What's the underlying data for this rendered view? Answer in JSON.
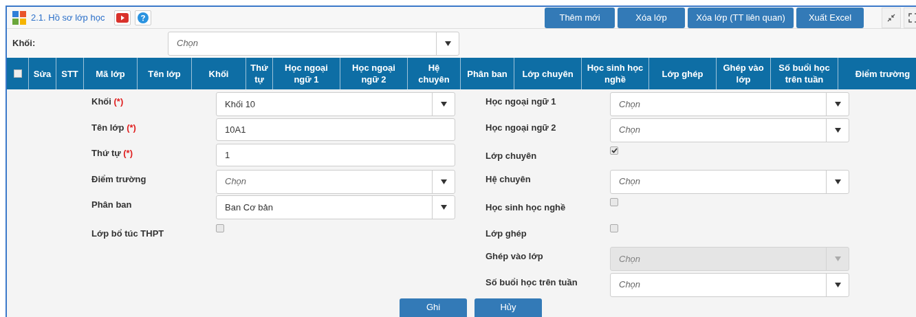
{
  "header": {
    "title": "2.1. Hồ sơ lớp học",
    "actions": [
      "Thêm mới",
      "Xóa lớp",
      "Xóa lớp (TT liên quan)",
      "Xuất Excel"
    ]
  },
  "filter": {
    "label": "Khối:",
    "placeholder": "Chọn"
  },
  "table": {
    "select_all_checked": false,
    "columns": [
      "Sửa",
      "STT",
      "Mã lớp",
      "Tên lớp",
      "Khối",
      "Thứ tự",
      "Học ngoại ngữ 1",
      "Học ngoại ngữ 2",
      "Hệ chuyên",
      "Phân ban",
      "Lớp chuyên",
      "Học sinh học nghề",
      "Lớp ghép",
      "Ghép vào lớp",
      "Số buổi học trên tuần",
      "Điểm trường"
    ]
  },
  "form": {
    "left": [
      {
        "kind": "select",
        "label": "Khối",
        "required_mark": "(*)",
        "value": "Khối 10",
        "disabled": false
      },
      {
        "kind": "text",
        "label": "Tên lớp",
        "required_mark": "(*)",
        "value": "10A1"
      },
      {
        "kind": "text",
        "label": "Thứ tự",
        "required_mark": "(*)",
        "value": "1"
      },
      {
        "kind": "select",
        "label": "Điểm trường",
        "placeholder": "Chọn",
        "disabled": false
      },
      {
        "kind": "select",
        "label": "Phân ban",
        "value": "Ban Cơ bản",
        "disabled": false
      },
      {
        "kind": "checkbox",
        "label": "Lớp bổ túc THPT",
        "checked": false
      }
    ],
    "right": [
      {
        "kind": "select",
        "label": "Học ngoại ngữ 1",
        "placeholder": "Chọn",
        "disabled": false
      },
      {
        "kind": "select",
        "label": "Học ngoại ngữ 2",
        "placeholder": "Chọn",
        "disabled": false
      },
      {
        "kind": "checkbox",
        "label": "Lớp chuyên",
        "checked": true
      },
      {
        "kind": "select",
        "label": "Hệ chuyên",
        "placeholder": "Chọn",
        "disabled": false
      },
      {
        "kind": "checkbox",
        "label": "Học sinh học nghề",
        "checked": false
      },
      {
        "kind": "checkbox",
        "label": "Lớp ghép",
        "checked": false
      },
      {
        "kind": "select",
        "label": "Ghép vào lớp",
        "placeholder": "Chọn",
        "disabled": true
      },
      {
        "kind": "select",
        "label": "Số buổi học trên tuần",
        "placeholder": "Chọn",
        "disabled": false
      }
    ]
  },
  "footer_buttons": [
    "Ghi",
    "Hủy"
  ]
}
